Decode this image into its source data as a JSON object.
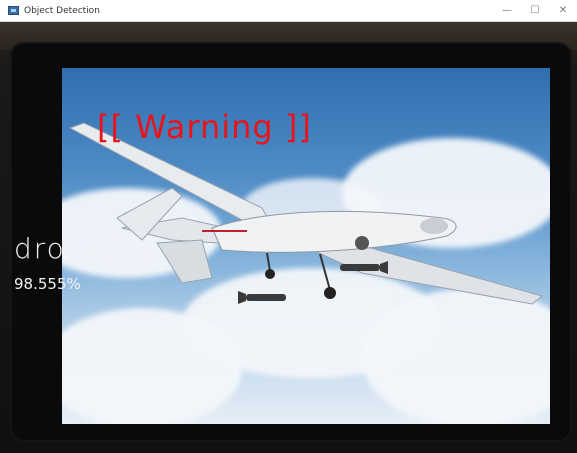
{
  "window": {
    "title": "Object Detection",
    "minimize_glyph": "—",
    "maximize_glyph": "☐",
    "close_glyph": "✕"
  },
  "detection": {
    "class_label": "drone",
    "confidence": "98.555%",
    "warning_text": "[[ Warning ]]",
    "warning_color": "#e8141a",
    "label_color": "#f2f2f2"
  },
  "icons": [
    "app-window-icon",
    "minimize-icon",
    "maximize-icon",
    "close-icon"
  ]
}
